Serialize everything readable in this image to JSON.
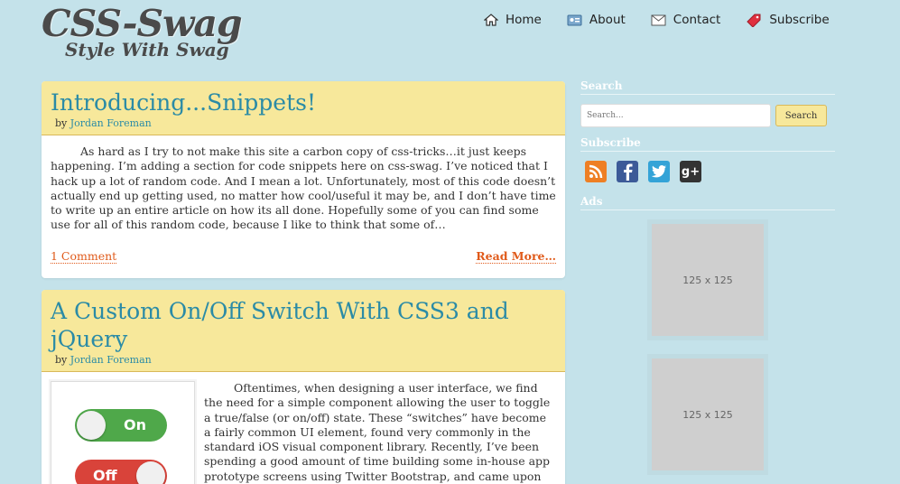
{
  "logo": {
    "title": "CSS-Swag",
    "tagline": "Style With Swag"
  },
  "nav": [
    {
      "label": "Home",
      "icon": "home-icon"
    },
    {
      "label": "About",
      "icon": "id-card-icon"
    },
    {
      "label": "Contact",
      "icon": "envelope-icon"
    },
    {
      "label": "Subscribe",
      "icon": "tag-icon"
    }
  ],
  "posts": [
    {
      "title": "Introducing...Snippets!",
      "by": "by",
      "author": "Jordan Foreman",
      "excerpt": "As hard as I try to not make this site a carbon copy of css-tricks…it just keeps happening. I’m adding a section for code snippets here on css-swag. I’ve noticed that I hack up a lot of random code. And I mean a lot. Unfortunately, most of this code doesn’t actually end up getting used, no matter how cool/useful it may be, and I don’t have time to write up an entire article on how its all done. Hopefully some of you can find some use for all of this random code, because I like to think that some of…",
      "comments": "1 Comment",
      "read_more": "Read More…"
    },
    {
      "title": "A Custom On/Off Switch With CSS3 and jQuery",
      "by": "by",
      "author": "Jordan Foreman",
      "switch_on": "On",
      "switch_off": "Off",
      "excerpt": "Oftentimes, when designing a user interface, we find the need for a simple component allowing the user to toggle a true/false (or on/off) state. These “switches” have become a fairly common UI element, found very commonly in the standard iOS visual component library. Recently, I’ve been spending a good amount of time building some in-house app prototype screens using Twitter Bootstrap, and came upon the"
    }
  ],
  "sidebar": {
    "search_title": "Search",
    "search_placeholder": "Search...",
    "search_button": "Search",
    "subscribe_title": "Subscribe",
    "ads_title": "Ads",
    "ad_label": "125 x 125"
  },
  "colors": {
    "background": "#c4e2ea",
    "header_yellow": "#f7e89b",
    "link_blue": "#2b8ba6",
    "link_orange": "#e05a1a"
  }
}
